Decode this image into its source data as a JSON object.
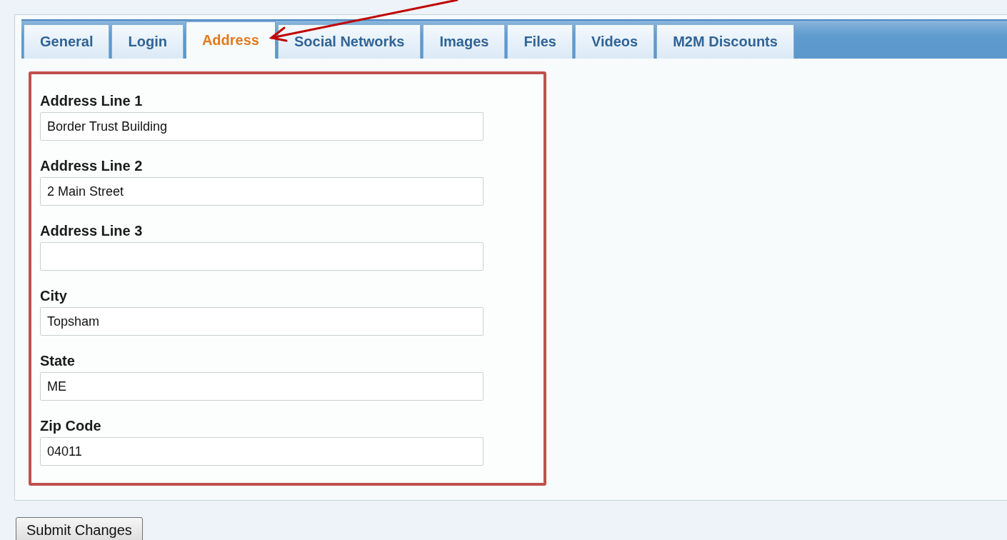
{
  "tabs": [
    {
      "label": "General",
      "selected": false
    },
    {
      "label": "Login",
      "selected": false
    },
    {
      "label": "Address",
      "selected": true
    },
    {
      "label": "Social Networks",
      "selected": false
    },
    {
      "label": "Images",
      "selected": false
    },
    {
      "label": "Files",
      "selected": false
    },
    {
      "label": "Videos",
      "selected": false
    },
    {
      "label": "M2M Discounts",
      "selected": false
    }
  ],
  "form": {
    "fields": [
      {
        "label": "Address Line 1",
        "value": "Border Trust Building"
      },
      {
        "label": "Address Line 2",
        "value": "2 Main Street"
      },
      {
        "label": "Address Line 3"
      },
      {
        "label": "City",
        "value": "Topsham"
      },
      {
        "label": "State",
        "value": "ME"
      },
      {
        "label": "Zip Code",
        "value": "04011"
      }
    ]
  },
  "buttons": [
    "Submit Changes"
  ]
}
